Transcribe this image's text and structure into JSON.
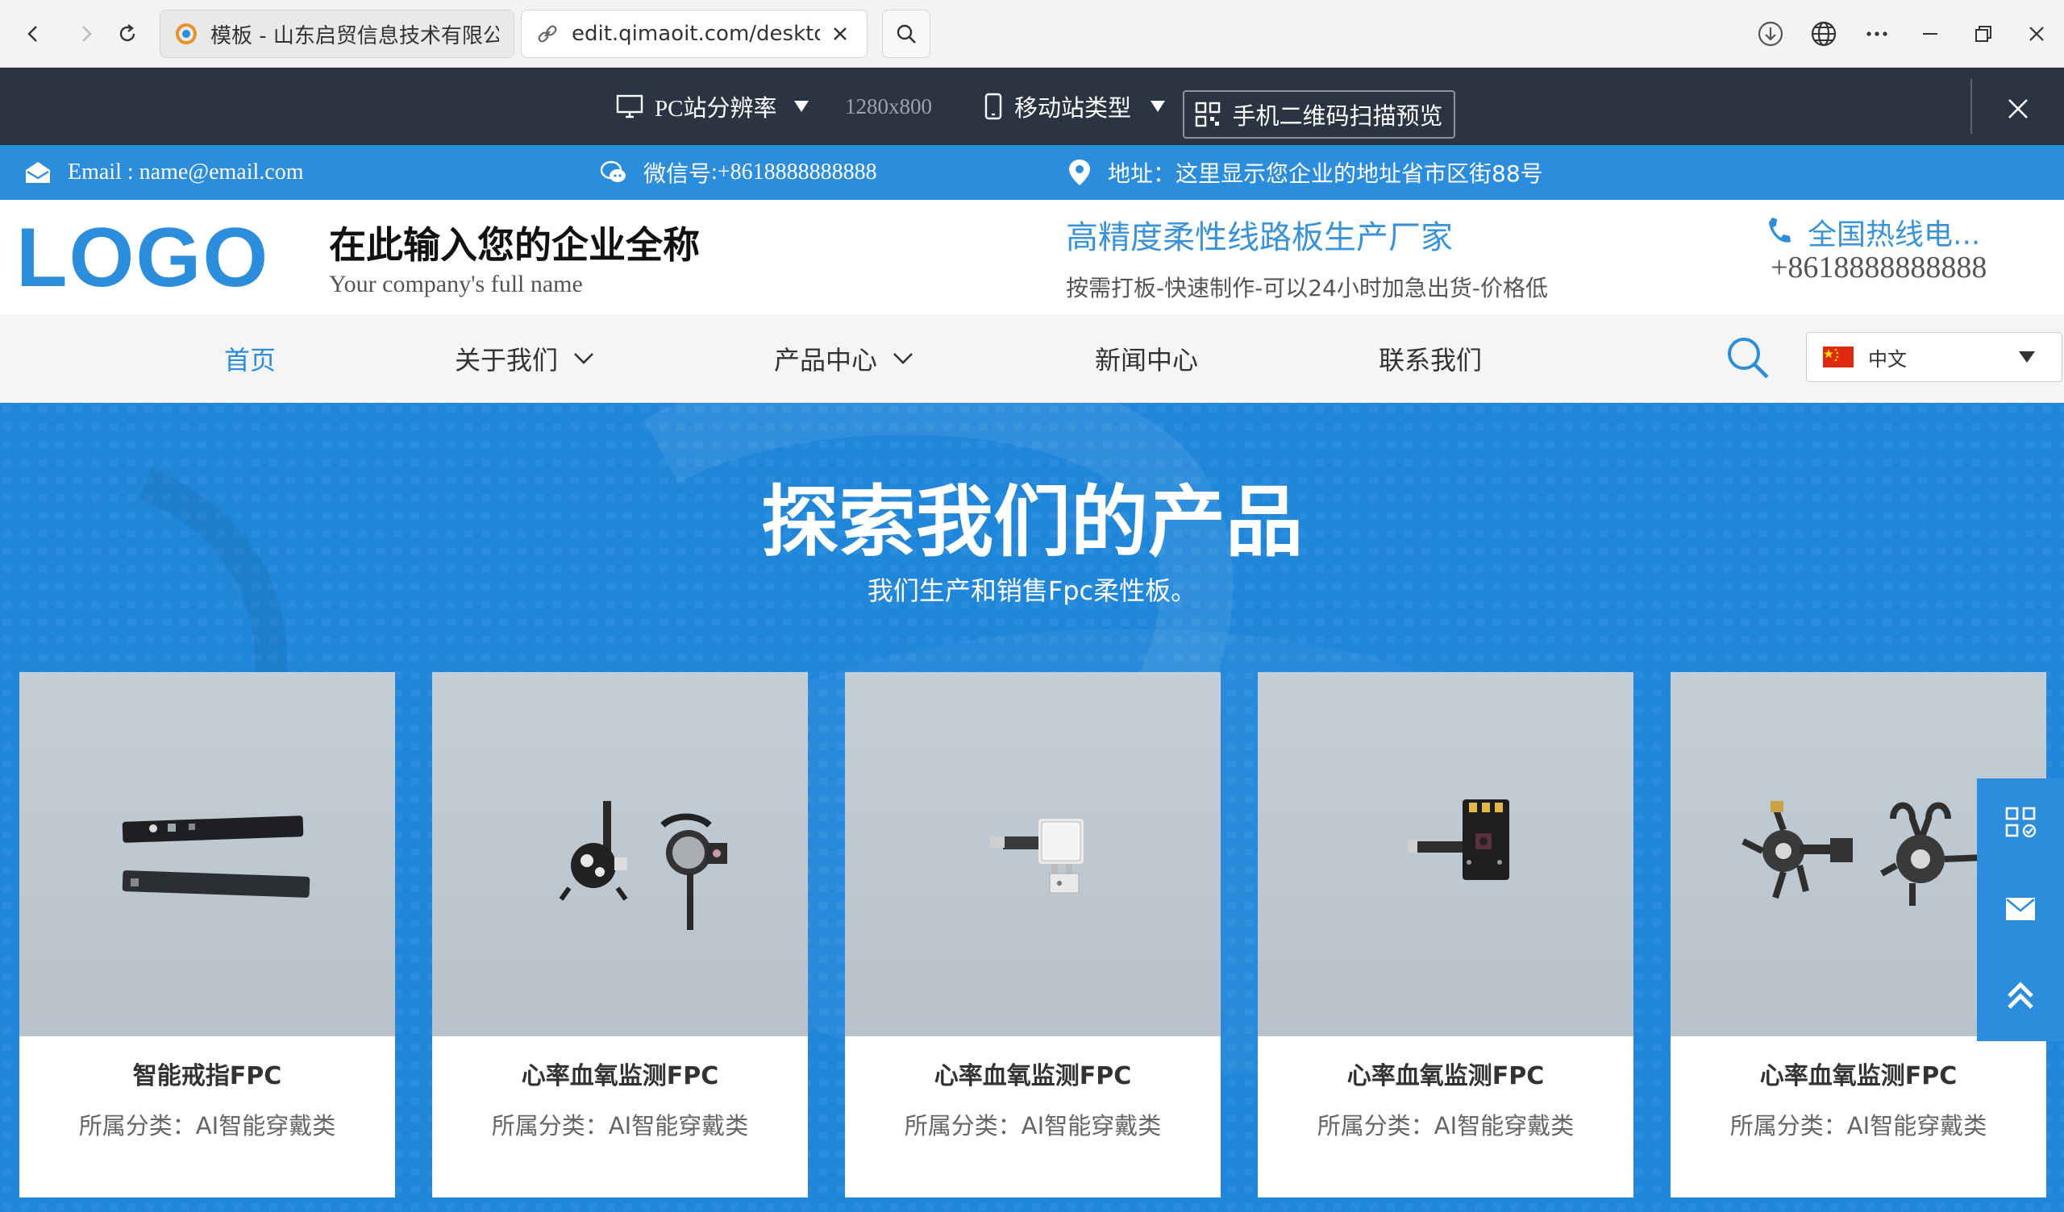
{
  "browser": {
    "tabs": [
      {
        "title": "模板 - 山东启贸信息技术有限公司",
        "active": false
      },
      {
        "title": "edit.qimaoit.com/desktop/H",
        "active": true
      }
    ]
  },
  "editor": {
    "pc_resolution_label": "PC站分辨率",
    "resolution_value": "1280x800",
    "mobile_type_label": "移动站类型",
    "qr_preview_label": "手机二维码扫描预览"
  },
  "info_bar": {
    "email": "Email : name@email.com",
    "wechat_prefix": "微信号",
    "wechat_value": ":+8618888888888",
    "address": "地址：这里显示您企业的地址省市区街88号"
  },
  "header": {
    "logo": "LOGO",
    "company_cn": "在此输入您的企业全称",
    "company_en": "Your company's full name",
    "slogan": "高精度柔性线路板生产厂家",
    "slogan_sub": "按需打板-快速制作-可以24小时加急出货-价格低",
    "hotline_label": "全国热线电...",
    "hotline_number": "+8618888888888"
  },
  "nav": {
    "items": [
      {
        "label": "首页",
        "active": true,
        "dropdown": false
      },
      {
        "label": "关于我们",
        "active": false,
        "dropdown": true
      },
      {
        "label": "产品中心",
        "active": false,
        "dropdown": true
      },
      {
        "label": "新闻中心",
        "active": false,
        "dropdown": false
      },
      {
        "label": "联系我们",
        "active": false,
        "dropdown": false
      }
    ],
    "language": "中文"
  },
  "hero": {
    "title": "探索我们的产品",
    "subtitle": "我们生产和销售Fpc柔性板。"
  },
  "products": [
    {
      "title": "智能戒指FPC",
      "category": "所属分类：AI智能穿戴类"
    },
    {
      "title": "心率血氧监测FPC",
      "category": "所属分类：AI智能穿戴类"
    },
    {
      "title": "心率血氧监测FPC",
      "category": "所属分类：AI智能穿戴类"
    },
    {
      "title": "心率血氧监测FPC",
      "category": "所属分类：AI智能穿戴类"
    },
    {
      "title": "心率血氧监测FPC",
      "category": "所属分类：AI智能穿戴类"
    }
  ],
  "colors": {
    "brand_blue": "#2b8ddc",
    "editor_bar": "#2b3442",
    "hero_blue": "#1f86d9"
  },
  "icons": {
    "side_tools": [
      "qrcode-icon",
      "mail-icon",
      "back-to-top-icon"
    ]
  }
}
